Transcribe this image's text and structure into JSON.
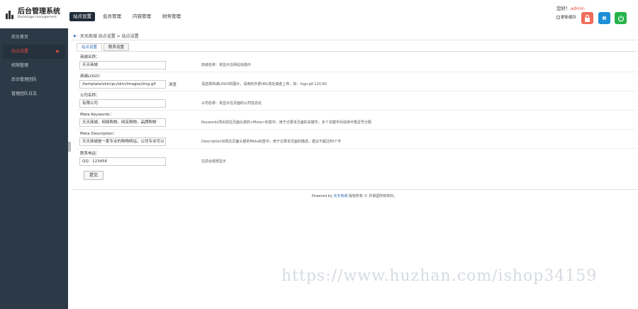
{
  "header": {
    "logo_title": "后台管理系统",
    "logo_subtitle": "Backstage management",
    "nav": [
      "站点设置",
      "会员管理",
      "内容管理",
      "财务管理"
    ],
    "greeting_prefix": "您好！",
    "username": "admin",
    "bind_label": "更新缓存",
    "icons": [
      "lock-icon",
      "ie-icon",
      "power-icon"
    ]
  },
  "sidebar": {
    "items": [
      "后台首页",
      "站点设置",
      "权限管理",
      "后台管理团队",
      "管理团队日志"
    ],
    "active_index": 1
  },
  "breadcrumb": "天天商城 站点设置 > 站点设置",
  "subtabs": [
    "站点设置",
    "联系设置"
  ],
  "form": [
    {
      "label": "商城名称：",
      "value": "天天商城",
      "hint": "商城名称：将显示在网站标题中"
    },
    {
      "label": "商城LOGO：",
      "value": "/template/skin/pc/skin/images/img.gif",
      "browse": "浏览",
      "hint": "请选择商城LOGO的图片，请用的外部URL地址或者上传，如：logo.gif,120,60"
    },
    {
      "label": "公司名称：",
      "value": "有限公司",
      "hint": "公司名称：将显示在页面的公司信息处"
    },
    {
      "label": "Meta Keywords：",
      "value": "天天商城，网络购物，网店购物，品牌购物",
      "hint": "Keywords项出现在页面头部的<Meta>标签中，用于记录本页面的关键字，多个关键字间请用半角逗号分隔"
    },
    {
      "label": "Meta Description：",
      "value": "天天商城是一家专业的购物网站，公司专业可以",
      "hint": "Description出现在页面头部的Meta标签中，用于记录本页面的描述，建议不超过80个字"
    },
    {
      "label": "联系电话：",
      "value": "QQ：123456",
      "hint": "在前台底部显示"
    }
  ],
  "submit_label": "提交",
  "footer": {
    "prefix": "Powered by ",
    "brand": "天天商城",
    "suffix": " 版权所有 © 并保留所有权利。"
  },
  "watermark": "https://www.huzhan.com/ishop34159"
}
